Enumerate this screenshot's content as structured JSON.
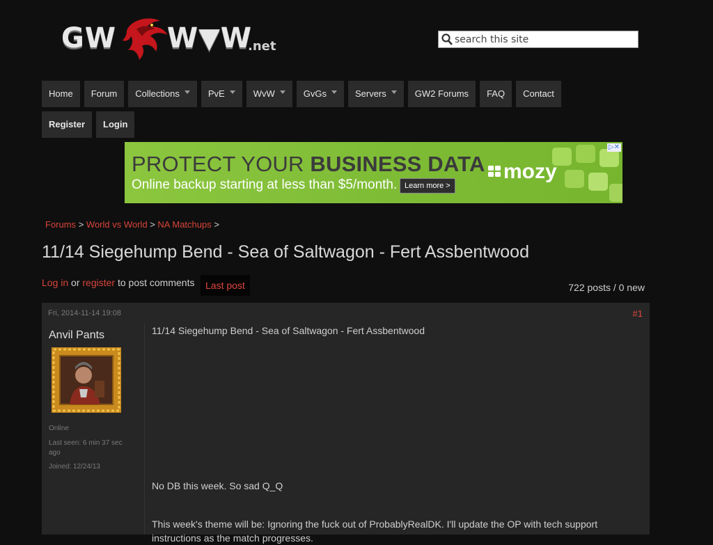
{
  "logo": {
    "gw": "GW",
    "ww": "W▼W",
    "net": ".net",
    "dragon_color": "#c4161c"
  },
  "search": {
    "placeholder": "search this site",
    "value": ""
  },
  "nav": {
    "row1": [
      {
        "label": "Home",
        "dropdown": false
      },
      {
        "label": "Forum",
        "dropdown": false
      },
      {
        "label": "Collections",
        "dropdown": true
      },
      {
        "label": "PvE",
        "dropdown": true
      },
      {
        "label": "WvW",
        "dropdown": true
      },
      {
        "label": "GvGs",
        "dropdown": true
      },
      {
        "label": "Servers",
        "dropdown": true
      },
      {
        "label": "GW2 Forums",
        "dropdown": false
      },
      {
        "label": "FAQ",
        "dropdown": false
      },
      {
        "label": "Contact",
        "dropdown": false
      }
    ],
    "row2": [
      {
        "label": "Register"
      },
      {
        "label": "Login"
      }
    ]
  },
  "ad": {
    "headline_a": "PROTECT YOUR ",
    "headline_b": "BUSINESS DATA",
    "subline": "Online backup starting at less than $5/month.",
    "button": "Learn more >",
    "brand": "mozy",
    "adchoices": "▷✕",
    "bg_color": "#8cc63f"
  },
  "breadcrumb": {
    "items": [
      "Forums",
      "World vs World",
      "NA Matchups"
    ],
    "separator": ">"
  },
  "page_title": "11/14 Siegehump Bend - Sea of Saltwagon - Fert Assbentwood",
  "comment_bar": {
    "login_link": "Log in",
    "or_text": "or",
    "register_link": "register",
    "suffix": "to post comments",
    "last_post": "Last post",
    "post_count": "722 posts / 0 new"
  },
  "post": {
    "date": "Fri, 2014-11-14 19:08",
    "number": "#1",
    "author": "Anvil Pants",
    "status": "Online",
    "last_seen": "Last seen: 6 min 37 sec ago",
    "joined": "Joined: 12/24/13",
    "subject": "11/14 Siegehump Bend - Sea of Saltwagon - Fert Assbentwood",
    "paragraph_1": "No DB this week. So sad Q_Q",
    "paragraph_2": "This week's theme will be: Ignoring the fuck out of ProbablyRealDK. I'll update the OP with tech support instructions as the match progresses."
  },
  "colors": {
    "accent_red": "#d9443a",
    "nav_bg": "#2b2b2b",
    "page_bg": "#0f0f0f",
    "post_bg": "#262626"
  }
}
